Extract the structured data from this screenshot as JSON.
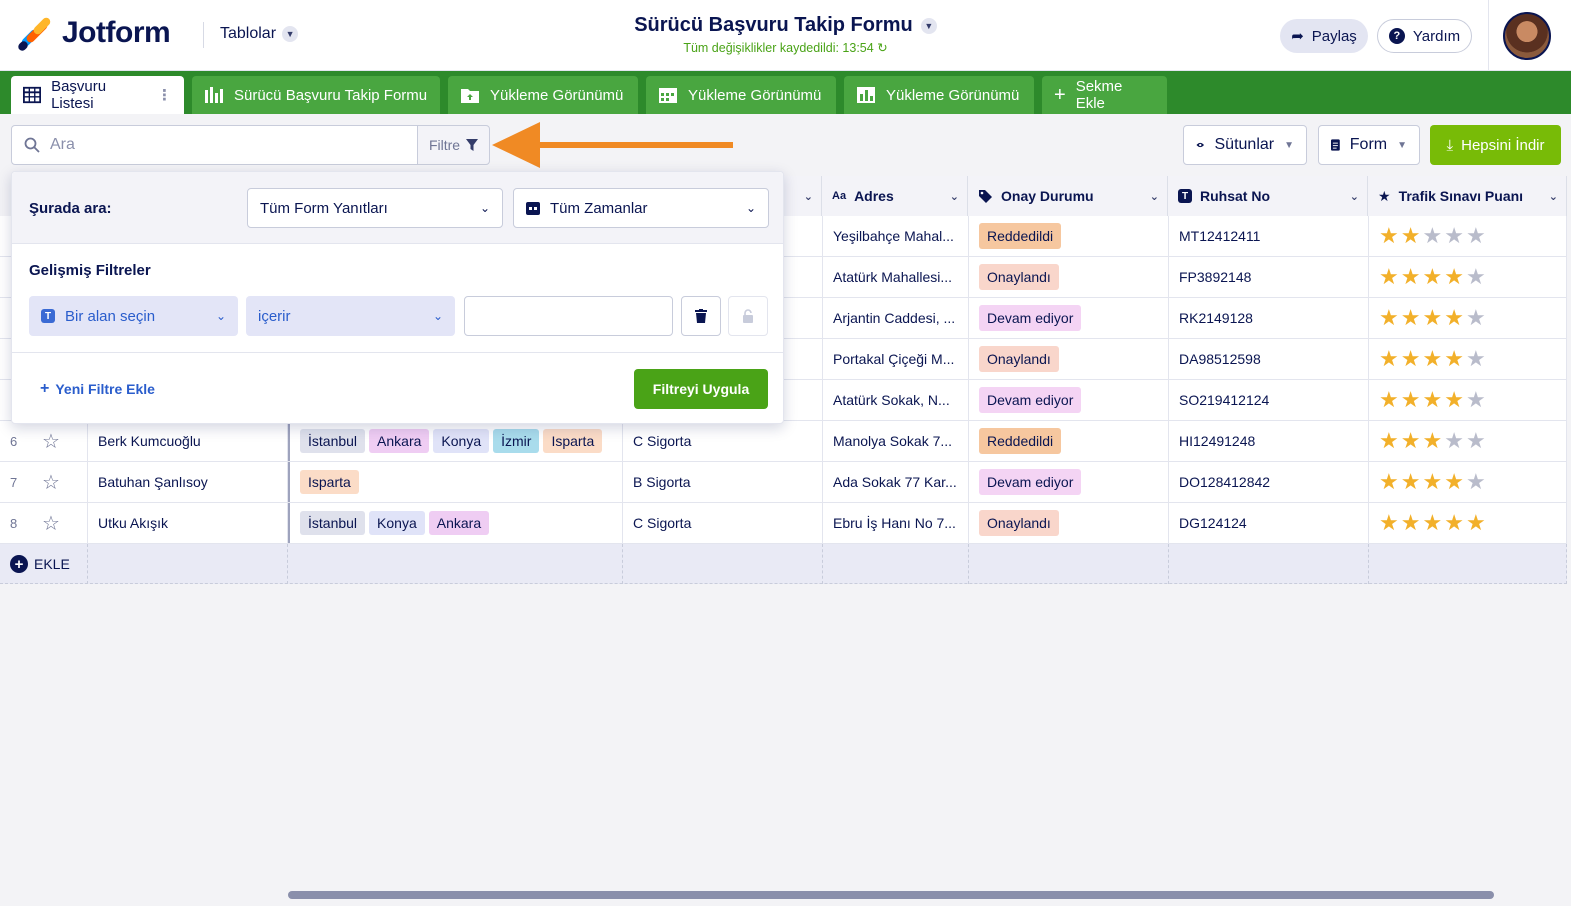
{
  "app": {
    "logo_text": "Jotform",
    "tables_label": "Tablolar",
    "title": "Sürücü Başvuru Takip Formu",
    "saved_status": "Tüm değişiklikler kaydedildi: 13:54",
    "share_label": "Paylaş",
    "help_label": "Yardım"
  },
  "tabs": [
    {
      "label": "Başvuru Listesi",
      "icon": "table-icon",
      "active": true
    },
    {
      "label": "Sürücü Başvuru Takip Formu",
      "icon": "report-icon"
    },
    {
      "label": "Yükleme Görünümü",
      "icon": "folder-icon"
    },
    {
      "label": "Yükleme Görünümü",
      "icon": "calendar-icon"
    },
    {
      "label": "Yükleme Görünümü",
      "icon": "chart-icon"
    },
    {
      "label": "Sekme Ekle",
      "icon": "plus-icon"
    }
  ],
  "toolbar": {
    "search_placeholder": "Ara",
    "filter_label": "Filtre",
    "columns_label": "Sütunlar",
    "form_label": "Form",
    "download_label": "Hepsini İndir"
  },
  "columns": [
    {
      "label": "Adres",
      "icon": "Aa"
    },
    {
      "label": "Onay Durumu",
      "icon": "tag-icon"
    },
    {
      "label": "Ruhsat No",
      "icon": "T"
    },
    {
      "label": "Trafik Sınavı Puanı",
      "icon": "star-icon"
    }
  ],
  "rows": [
    {
      "num": "",
      "name": "",
      "cities": [],
      "insurance": "",
      "address": "Yeşilbahçe Mahal...",
      "status": "Reddedildi",
      "license": "MT12412411",
      "rating": 2
    },
    {
      "num": "",
      "name": "",
      "cities": [],
      "insurance": "",
      "address": "Atatürk Mahallesi...",
      "status": "Onaylandı",
      "license": "FP3892148",
      "rating": 4
    },
    {
      "num": "",
      "name": "",
      "cities": [],
      "insurance": "",
      "address": "Arjantin Caddesi, ...",
      "status": "Devam ediyor",
      "license": "RK2149128",
      "rating": 4
    },
    {
      "num": "",
      "name": "",
      "cities": [],
      "insurance": "",
      "address": "Portakal Çiçeği M...",
      "status": "Onaylandı",
      "license": "DA98512598",
      "rating": 4
    },
    {
      "num": "",
      "name": "",
      "cities": [],
      "insurance": "",
      "address": "Atatürk Sokak, N...",
      "status": "Devam ediyor",
      "license": "SO219412124",
      "rating": 4
    },
    {
      "num": "6",
      "name": "Berk Kumcuoğlu",
      "cities": [
        "İstanbul",
        "Ankara",
        "Konya",
        "İzmir",
        "Isparta"
      ],
      "insurance": "C Sigorta",
      "address": "Manolya Sokak 7...",
      "status": "Reddedildi",
      "license": "HI12491248",
      "rating": 3
    },
    {
      "num": "7",
      "name": "Batuhan Şanlısoy",
      "cities": [
        "Isparta"
      ],
      "insurance": "B Sigorta",
      "address": "Ada Sokak 77 Kar...",
      "status": "Devam ediyor",
      "license": "DO128412842",
      "rating": 4
    },
    {
      "num": "8",
      "name": "Utku Akışık",
      "cities": [
        "İstanbul",
        "Konya",
        "Ankara"
      ],
      "insurance": "C Sigorta",
      "address": "Ebru İş Hanı No 7...",
      "status": "Onaylandı",
      "license": "DG124124",
      "rating": 5
    }
  ],
  "add_row_label": "EKLE",
  "filter_panel": {
    "search_in_label": "Şurada ara:",
    "scope_value": "Tüm Form Yanıtları",
    "time_value": "Tüm Zamanlar",
    "advanced_label": "Gelişmiş Filtreler",
    "field_placeholder": "Bir alan seçin",
    "operator_value": "içerir",
    "add_filter_label": "Yeni Filtre Ekle",
    "apply_label": "Filtreyi Uygula"
  },
  "colors": {
    "status": {
      "Reddedildi": "#f6c79f",
      "Onaylandı": "#f9d6cb",
      "Devam ediyor": "#f4d4f4"
    },
    "cities": {
      "İstanbul": "#dfe1ec",
      "Ankara": "#efcdf3",
      "Konya": "#e0e3f8",
      "İzmir": "#a9dcec",
      "Isparta": "#fbdcc7"
    },
    "tab_green": "#2d8a2b",
    "accent_arrow": "#f08a24"
  }
}
